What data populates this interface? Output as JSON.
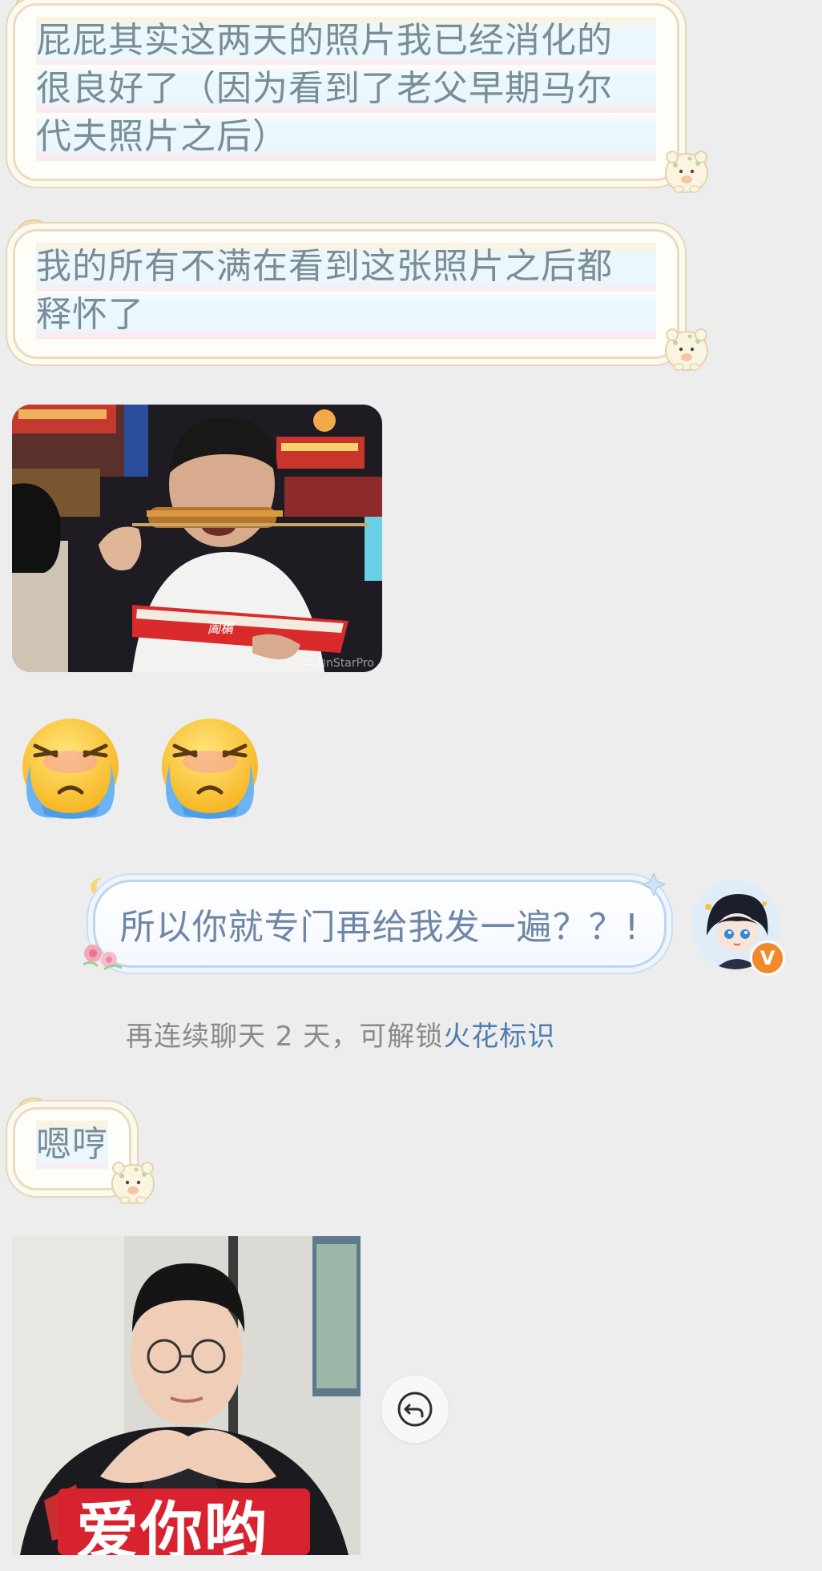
{
  "messages": {
    "m1": {
      "lines": [
        "屁屁其实这两天的照片我已经消化的",
        "很良好了（因为看到了老父早期马尔",
        "代夫照片之后）"
      ]
    },
    "m2": {
      "lines": [
        "我的所有不满在看到这张照片之后都",
        "释怀了"
      ]
    },
    "photo1": {
      "watermark": "华为nStarPro",
      "bag_text": "阖榍"
    },
    "emoji": [
      "crying-emoji",
      "crying-emoji"
    ],
    "m3_out": {
      "text": "所以你就专门再给我发一遍？？!"
    },
    "m4": {
      "text": "嗯哼"
    },
    "photo2": {
      "caption": "爱你哟"
    }
  },
  "system_tip": {
    "prefix": "再连续聊天 2 天，可解锁",
    "link": "火花标识"
  },
  "avatar": {
    "badge": "V"
  },
  "colors": {
    "background": "#ededed",
    "bubble_text": "#7c8c97",
    "right_bubble_text": "#6f86a7",
    "link": "#4f7db0",
    "badge": "#f08a2a",
    "caption_bg": "#d9222f"
  },
  "icons": [
    "bread-icon",
    "hamster-icon",
    "crying-emoji",
    "reply-icon",
    "verified-badge-icon",
    "moon-icon",
    "flower-icon"
  ]
}
